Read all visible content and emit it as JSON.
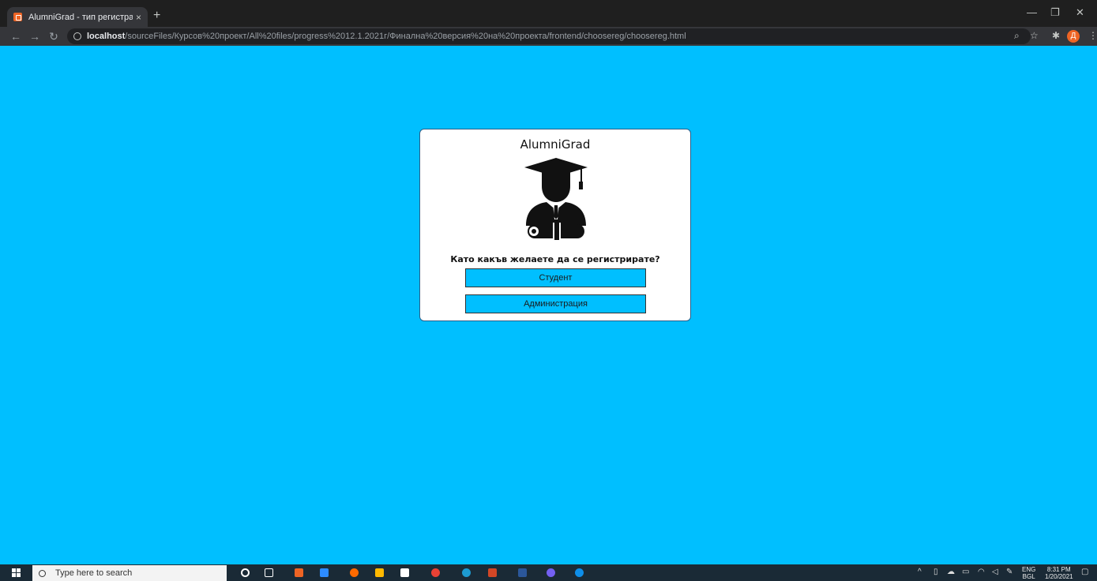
{
  "browser": {
    "tab_title": "AlumniGrad - тип регистрация",
    "tab_close": "×",
    "new_tab": "+",
    "url_host": "localhost",
    "url_path": "/sourceFiles/Курсов%20проект/All%20files/progress%2012.1.2021г/Финална%20версия%20на%20проекта/frontend/choosereg/choosereg.html",
    "profile_initial": "Д"
  },
  "page": {
    "brand": "AlumniGrad",
    "question": "Като какъв желаете да се регистрирате?",
    "buttons": {
      "student": "Студент",
      "admin": "Администрация"
    },
    "background_color": "#00bfff"
  },
  "taskbar": {
    "search_placeholder": "Type here to search",
    "language_top": "ENG",
    "language_bottom": "BGL",
    "time": "8:31 PM",
    "date": "1/20/2021"
  }
}
